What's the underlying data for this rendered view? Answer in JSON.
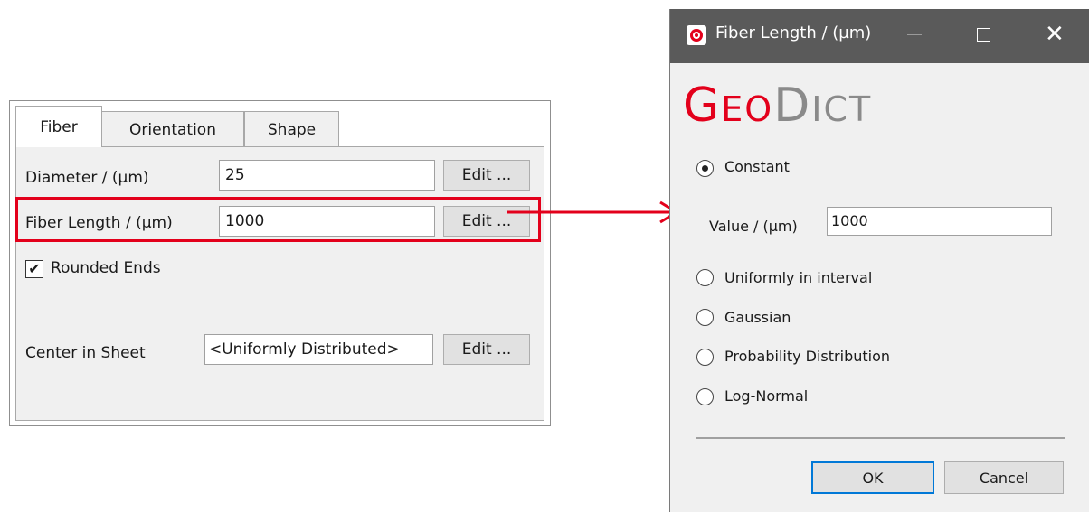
{
  "panel": {
    "tabs": [
      "Fiber",
      "Orientation",
      "Shape"
    ],
    "diameter": {
      "label": "Diameter / (µm)",
      "value": "25",
      "edit": "Edit ..."
    },
    "fiber_length": {
      "label": "Fiber Length / (µm)",
      "value": "1000",
      "edit": "Edit ..."
    },
    "rounded_ends": {
      "label": "Rounded Ends",
      "checked": true,
      "check_glyph": "✔"
    },
    "center": {
      "label": "Center in Sheet",
      "value": "<Uniformly Distributed>",
      "edit": "Edit ..."
    }
  },
  "dialog": {
    "title": "Fiber Length / (µm)",
    "window_controls": {
      "close_glyph": "✕"
    },
    "logo": {
      "part1_first": "G",
      "part1_rest": "EO",
      "part2_first": "D",
      "part2_rest": "ICT"
    },
    "options": [
      {
        "label": "Constant",
        "selected": true
      },
      {
        "label": "Uniformly in interval",
        "selected": false
      },
      {
        "label": "Gaussian",
        "selected": false
      },
      {
        "label": "Probability Distribution",
        "selected": false
      },
      {
        "label": "Log-Normal",
        "selected": false
      }
    ],
    "value_label": "Value / (µm)",
    "value": "1000",
    "ok": "OK",
    "cancel": "Cancel"
  },
  "colors": {
    "highlight": "#e3001b",
    "titlebar": "#5a5a5a",
    "brand_red": "#e3001b",
    "brand_grey": "#8a8a8a"
  }
}
